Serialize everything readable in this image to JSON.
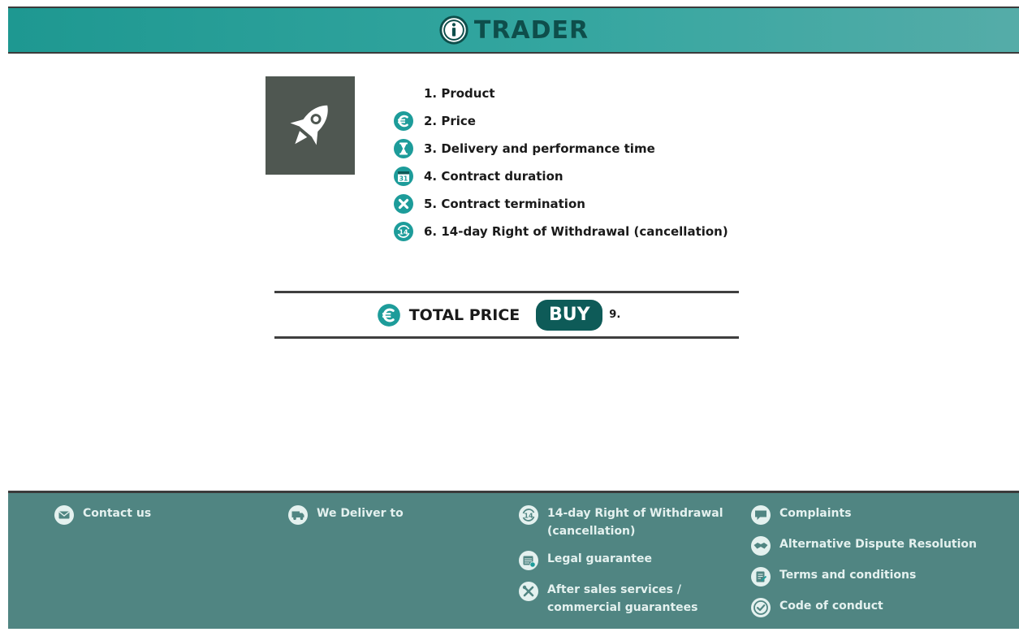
{
  "header": {
    "title": "TRADER",
    "icon": "info-circle-icon"
  },
  "product": {
    "image_icon": "rocket-icon"
  },
  "info_items": [
    {
      "label": "1. Product",
      "icon": ""
    },
    {
      "label": "2. Price",
      "icon": "euro-icon"
    },
    {
      "label": "3. Delivery and performance  time",
      "icon": "hourglass-icon"
    },
    {
      "label": "4. Contract duration",
      "icon": "calendar-31-icon"
    },
    {
      "label": "5. Contract termination",
      "icon": "close-circle-icon"
    },
    {
      "label": "6. 14-day Right of Withdrawal (cancellation)",
      "icon": "14-day-cycle-icon"
    }
  ],
  "purchase": {
    "total_label": "TOTAL PRICE",
    "buy_label": "BUY",
    "step_label": "9."
  },
  "footer": {
    "contact": "Contact us",
    "delivery": "We Deliver to",
    "withdrawal": "14-day Right of Withdrawal (cancellation)",
    "legal_guarantee": "Legal guarantee",
    "after_sales": "After sales services / commercial guarantees",
    "complaints": "Complaints",
    "adr": "Alternative Dispute Resolution",
    "terms": "Terms and conditions",
    "code_of_conduct": "Code of conduct"
  },
  "colors": {
    "header_gradient_start": "#1e9891",
    "header_gradient_end": "#55aca8",
    "title": "#0e4e4b",
    "icon_teal": "#1d9c9a",
    "buy_button": "#0e5b58",
    "product_tile": "#4f5751",
    "footer_bg": "#508582",
    "footer_text": "#e4f1ef"
  }
}
